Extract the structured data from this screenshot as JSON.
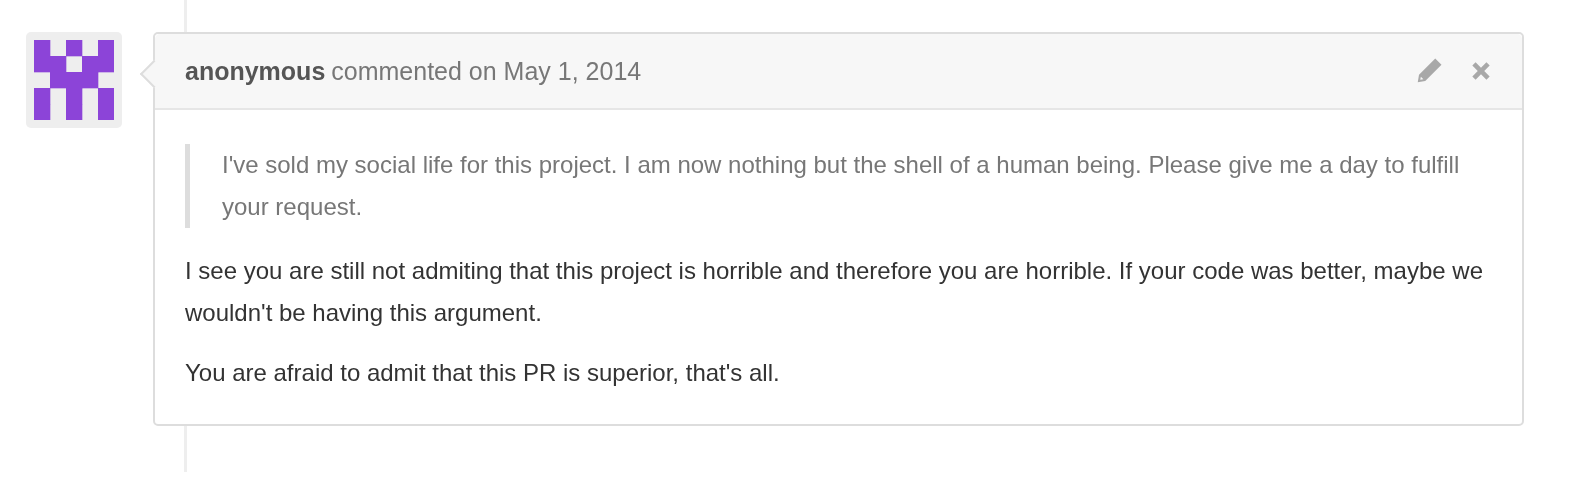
{
  "comment": {
    "author": "anonymous",
    "action": "commented on May 1, 2014",
    "quote": "I've sold my social life for this project. I am now nothing but the shell of a human being. Please give me a day to fulfill your request.",
    "paragraphs": [
      "I see you are still not admiting that this project is horrible and therefore you are horrible. If your code was better, maybe we wouldn't be having this argument.",
      "You are afraid to admit that this PR is superior, that's all."
    ]
  }
}
